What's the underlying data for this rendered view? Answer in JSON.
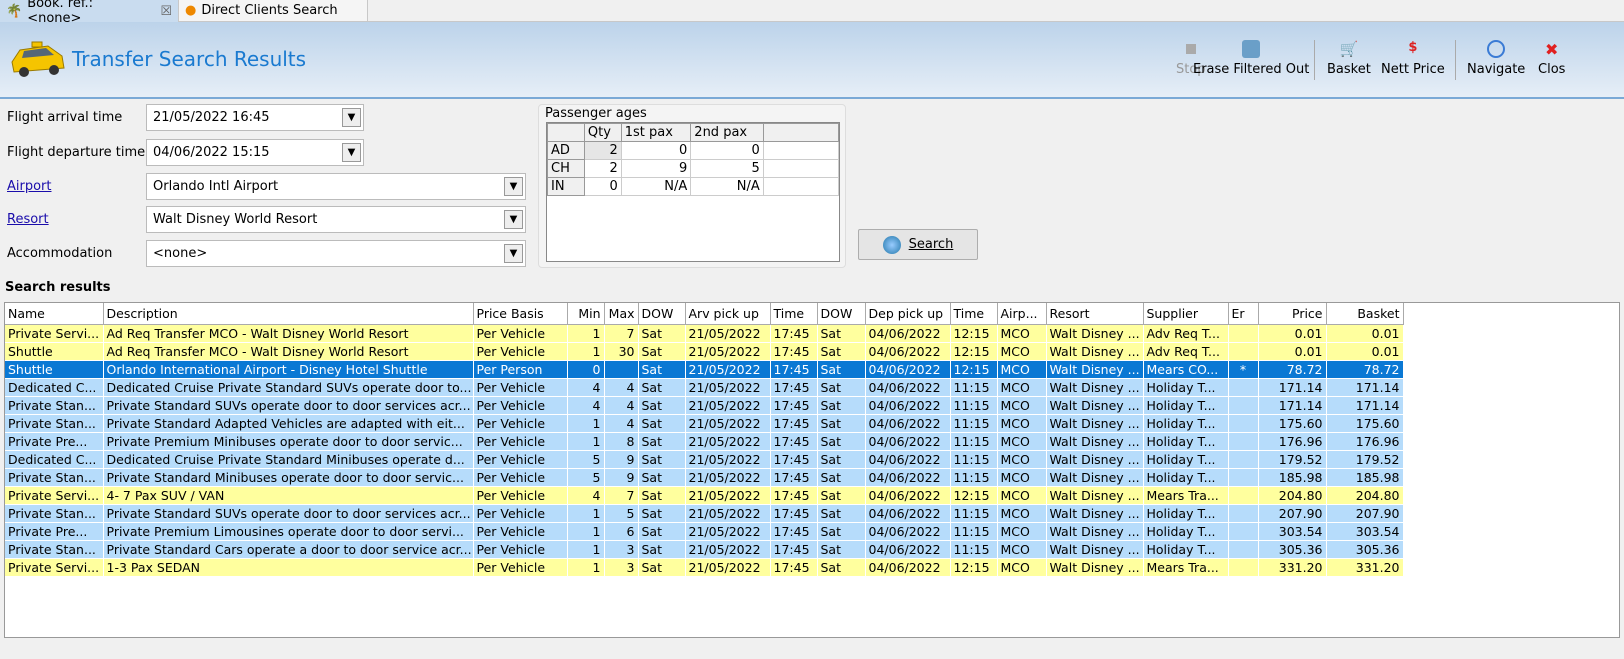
{
  "tabs": [
    {
      "label": "Book. ref.: <none>",
      "close": "☒"
    },
    {
      "label": "Direct Clients Search"
    }
  ],
  "header": {
    "title": "Transfer Search Results"
  },
  "toolbar": {
    "stop": "Stop",
    "erase": "Erase Filtered Out",
    "basket": "Basket",
    "nett": "Nett Price",
    "navigate": "Navigate",
    "close": "Clos"
  },
  "form": {
    "arrival_label": "Flight arrival time",
    "arrival_value": "21/05/2022 16:45",
    "departure_label": "Flight departure time",
    "departure_value": "04/06/2022 15:15",
    "airport_label": "Airport",
    "airport_value": "Orlando Intl Airport",
    "resort_label": "Resort",
    "resort_value": "Walt Disney World Resort",
    "accom_label": "Accommodation",
    "accom_value": "<none>"
  },
  "pax": {
    "title": "Passenger ages",
    "headers": [
      "",
      "Qty",
      "1st pax",
      "2nd pax",
      ""
    ],
    "rows": [
      [
        "AD",
        "2",
        "0",
        "0"
      ],
      [
        "CH",
        "2",
        "9",
        "5"
      ],
      [
        "IN",
        "0",
        "N/A",
        "N/A"
      ]
    ]
  },
  "search_button": "Search",
  "results": {
    "title": "Search results",
    "columns": [
      "Name",
      "Description",
      "Price Basis",
      "Min",
      "Max",
      "DOW",
      "Arv pick up",
      "Time",
      "DOW",
      "Dep pick up",
      "Time",
      "Airp...",
      "Resort",
      "Supplier",
      "Er",
      "Price",
      "Basket"
    ],
    "rows": [
      {
        "style": "y",
        "cells": [
          "Private Servi...",
          "Ad Req Transfer MCO - Walt Disney World Resort",
          "Per Vehicle",
          "1",
          "7",
          "Sat",
          "21/05/2022",
          "17:45",
          "Sat",
          "04/06/2022",
          "12:15",
          "MCO",
          "Walt Disney ...",
          "Adv Req T...",
          "",
          "0.01",
          "0.01"
        ]
      },
      {
        "style": "y",
        "cells": [
          "Shuttle",
          "Ad Req Transfer MCO - Walt Disney World Resort",
          "Per Vehicle",
          "1",
          "30",
          "Sat",
          "21/05/2022",
          "17:45",
          "Sat",
          "04/06/2022",
          "12:15",
          "MCO",
          "Walt Disney ...",
          "Adv Req T...",
          "",
          "0.01",
          "0.01"
        ]
      },
      {
        "style": "s",
        "cells": [
          "Shuttle",
          "Orlando International Airport - Disney Hotel Shuttle",
          "Per Person",
          "0",
          "",
          "Sat",
          "21/05/2022",
          "17:45",
          "Sat",
          "04/06/2022",
          "12:15",
          "MCO",
          "Walt Disney ...",
          "Mears CO...",
          "*",
          "78.72",
          "78.72"
        ]
      },
      {
        "style": "b",
        "cells": [
          "Dedicated C...",
          "Dedicated Cruise Private Standard SUVs operate door to...",
          "Per Vehicle",
          "4",
          "4",
          "Sat",
          "21/05/2022",
          "17:45",
          "Sat",
          "04/06/2022",
          "11:15",
          "MCO",
          "Walt Disney ...",
          "Holiday T...",
          "",
          "171.14",
          "171.14"
        ]
      },
      {
        "style": "b",
        "cells": [
          "Private Stan...",
          "Private Standard SUVs operate door to door services acr...",
          "Per Vehicle",
          "4",
          "4",
          "Sat",
          "21/05/2022",
          "17:45",
          "Sat",
          "04/06/2022",
          "11:15",
          "MCO",
          "Walt Disney ...",
          "Holiday T...",
          "",
          "171.14",
          "171.14"
        ]
      },
      {
        "style": "b",
        "cells": [
          "Private Stan...",
          "Private Standard Adapted Vehicles are adapted with eit...",
          "Per Vehicle",
          "1",
          "4",
          "Sat",
          "21/05/2022",
          "17:45",
          "Sat",
          "04/06/2022",
          "11:15",
          "MCO",
          "Walt Disney ...",
          "Holiday T...",
          "",
          "175.60",
          "175.60"
        ]
      },
      {
        "style": "b",
        "cells": [
          "Private Pre...",
          "Private Premium Minibuses operate door to door servic...",
          "Per Vehicle",
          "1",
          "8",
          "Sat",
          "21/05/2022",
          "17:45",
          "Sat",
          "04/06/2022",
          "11:15",
          "MCO",
          "Walt Disney ...",
          "Holiday T...",
          "",
          "176.96",
          "176.96"
        ]
      },
      {
        "style": "b",
        "cells": [
          "Dedicated C...",
          "Dedicated Cruise Private Standard Minibuses operate d...",
          "Per Vehicle",
          "5",
          "9",
          "Sat",
          "21/05/2022",
          "17:45",
          "Sat",
          "04/06/2022",
          "11:15",
          "MCO",
          "Walt Disney ...",
          "Holiday T...",
          "",
          "179.52",
          "179.52"
        ]
      },
      {
        "style": "b",
        "cells": [
          "Private Stan...",
          "Private Standard Minibuses operate door to door servic...",
          "Per Vehicle",
          "5",
          "9",
          "Sat",
          "21/05/2022",
          "17:45",
          "Sat",
          "04/06/2022",
          "11:15",
          "MCO",
          "Walt Disney ...",
          "Holiday T...",
          "",
          "185.98",
          "185.98"
        ]
      },
      {
        "style": "y",
        "cells": [
          "Private Servi...",
          "4- 7 Pax SUV / VAN",
          "Per Vehicle",
          "4",
          "7",
          "Sat",
          "21/05/2022",
          "17:45",
          "Sat",
          "04/06/2022",
          "12:15",
          "MCO",
          "Walt Disney ...",
          "Mears Tra...",
          "",
          "204.80",
          "204.80"
        ]
      },
      {
        "style": "b",
        "cells": [
          "Private Stan...",
          "Private Standard SUVs operate door to door services acr...",
          "Per Vehicle",
          "1",
          "5",
          "Sat",
          "21/05/2022",
          "17:45",
          "Sat",
          "04/06/2022",
          "11:15",
          "MCO",
          "Walt Disney ...",
          "Holiday T...",
          "",
          "207.90",
          "207.90"
        ]
      },
      {
        "style": "b",
        "cells": [
          "Private Pre...",
          "Private Premium Limousines operate door to door servi...",
          "Per Vehicle",
          "1",
          "6",
          "Sat",
          "21/05/2022",
          "17:45",
          "Sat",
          "04/06/2022",
          "11:15",
          "MCO",
          "Walt Disney ...",
          "Holiday T...",
          "",
          "303.54",
          "303.54"
        ]
      },
      {
        "style": "b",
        "cells": [
          "Private Stan...",
          "Private Standard Cars operate a door to door service acr...",
          "Per Vehicle",
          "1",
          "3",
          "Sat",
          "21/05/2022",
          "17:45",
          "Sat",
          "04/06/2022",
          "11:15",
          "MCO",
          "Walt Disney ...",
          "Holiday T...",
          "",
          "305.36",
          "305.36"
        ]
      },
      {
        "style": "y",
        "cells": [
          "Private Servi...",
          "1-3 Pax SEDAN",
          "Per Vehicle",
          "1",
          "3",
          "Sat",
          "21/05/2022",
          "17:45",
          "Sat",
          "04/06/2022",
          "12:15",
          "MCO",
          "Walt Disney ...",
          "Mears Tra...",
          "",
          "331.20",
          "331.20"
        ]
      }
    ]
  }
}
